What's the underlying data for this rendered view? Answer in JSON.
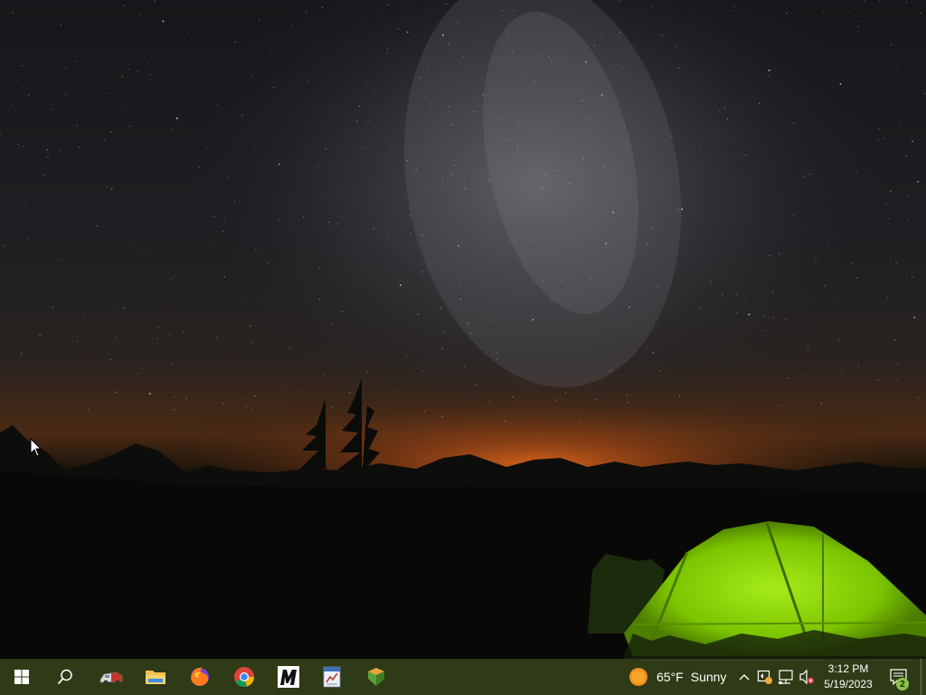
{
  "wallpaper": {
    "description_colors": {
      "sky": "#15171a",
      "horizon_glow": "#d2651e",
      "tent": "#8fd400"
    }
  },
  "taskbar": {
    "background_color": "#2f3a16",
    "pinned_apps": [
      {
        "name": "start",
        "icon": "windows-logo-icon"
      },
      {
        "name": "search",
        "icon": "search-icon"
      },
      {
        "name": "app-1",
        "icon": "rescue-vehicle-icon"
      },
      {
        "name": "file-explorer",
        "icon": "folder-icon"
      },
      {
        "name": "firefox",
        "icon": "firefox-icon"
      },
      {
        "name": "chrome",
        "icon": "chrome-icon"
      },
      {
        "name": "app-m",
        "icon": "m-letter-icon"
      },
      {
        "name": "app-2",
        "icon": "document-chart-icon"
      },
      {
        "name": "app-3",
        "icon": "shield-package-icon"
      }
    ],
    "weather": {
      "temperature": "65°F",
      "condition": "Sunny",
      "icon": "sun-icon"
    },
    "tray_icons": [
      "chevron-up-icon",
      "security-icon",
      "network-icon",
      "volume-muted-icon"
    ],
    "clock": {
      "time": "3:12 PM",
      "date": "5/19/2023"
    },
    "notifications": {
      "count": "2",
      "icon": "action-center-icon"
    }
  }
}
